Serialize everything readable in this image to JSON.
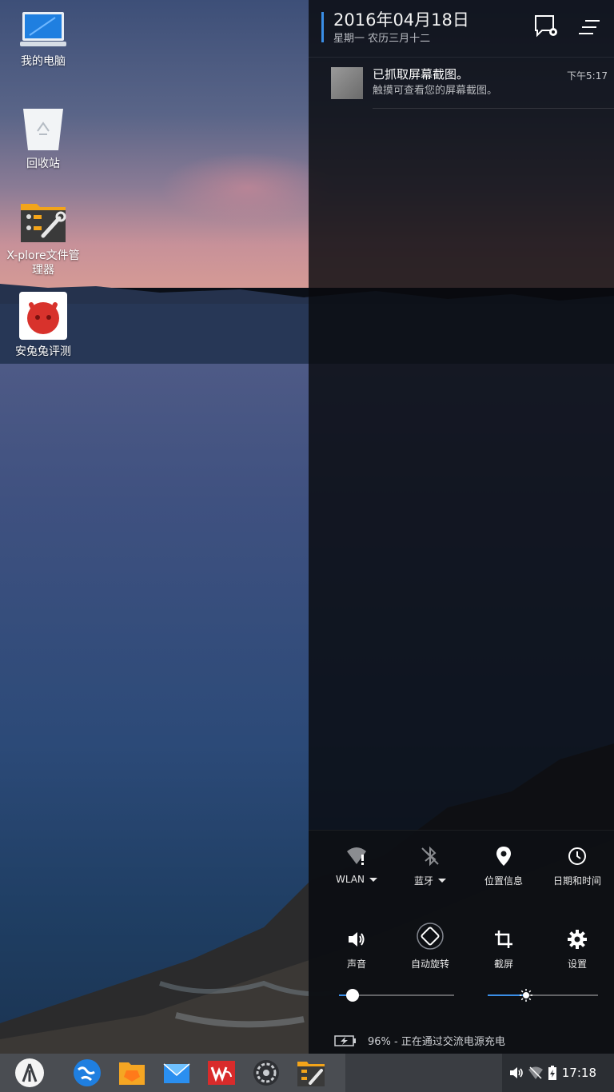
{
  "desktop": {
    "icons": [
      {
        "label": "我的电脑"
      },
      {
        "label": "回收站"
      },
      {
        "label": "X-plore文件管理器"
      },
      {
        "label": "安兔兔评测"
      }
    ]
  },
  "panel": {
    "date": "2016年04月18日",
    "subdate": "星期一 农历三月十二",
    "notification": {
      "title": "已抓取屏幕截图。",
      "text": "触摸可查看您的屏幕截图。",
      "time": "下午5:17"
    },
    "quick_settings": {
      "tiles": [
        {
          "label": "WLAN",
          "icon": "wifi-alert-icon"
        },
        {
          "label": "蓝牙",
          "icon": "bluetooth-off-icon"
        },
        {
          "label": "位置信息",
          "icon": "location-icon"
        },
        {
          "label": "日期和时间",
          "icon": "clock-icon"
        },
        {
          "label": "声音",
          "icon": "volume-icon"
        },
        {
          "label": "自动旋转",
          "icon": "rotate-icon"
        },
        {
          "label": "截屏",
          "icon": "crop-icon"
        },
        {
          "label": "设置",
          "icon": "gear-icon"
        }
      ],
      "volume_level": 0.12,
      "brightness_level": 0.35
    },
    "battery_text": "96% - 正在通过交流电源充电"
  },
  "taskbar": {
    "clock": "17:18"
  },
  "colors": {
    "accent": "#3a8ee6",
    "panel_bg": "#080a0e",
    "taskbar_bg": "#4a4d52"
  }
}
